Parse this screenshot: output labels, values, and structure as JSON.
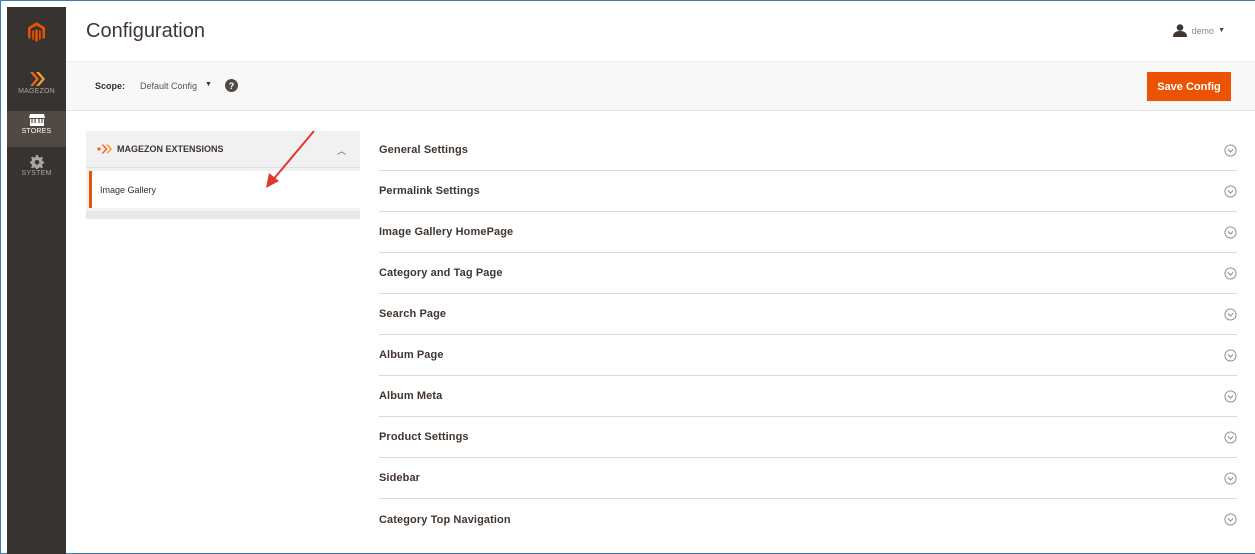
{
  "app": {
    "title": "Configuration",
    "user": "demo"
  },
  "sidebar": {
    "items": [
      {
        "label": "MAGEZON",
        "icon": "magezon-icon"
      },
      {
        "label": "STORES",
        "icon": "store-icon"
      },
      {
        "label": "SYSTEM",
        "icon": "gear-icon"
      }
    ]
  },
  "scope": {
    "label": "Scope:",
    "value": "Default Config"
  },
  "toolbar": {
    "save_label": "Save Config"
  },
  "tabs": {
    "group_title": "MAGEZON EXTENSIONS",
    "items": [
      {
        "label": "Image Gallery",
        "active": true
      }
    ]
  },
  "sections": [
    "General Settings",
    "Permalink Settings",
    "Image Gallery HomePage",
    "Category and Tag Page",
    "Search Page",
    "Album Page",
    "Album Meta",
    "Product Settings",
    "Sidebar",
    "Category Top Navigation"
  ],
  "colors": {
    "accent": "#eb5202",
    "sidebar_bg": "#373330",
    "sidebar_active": "#514943"
  }
}
